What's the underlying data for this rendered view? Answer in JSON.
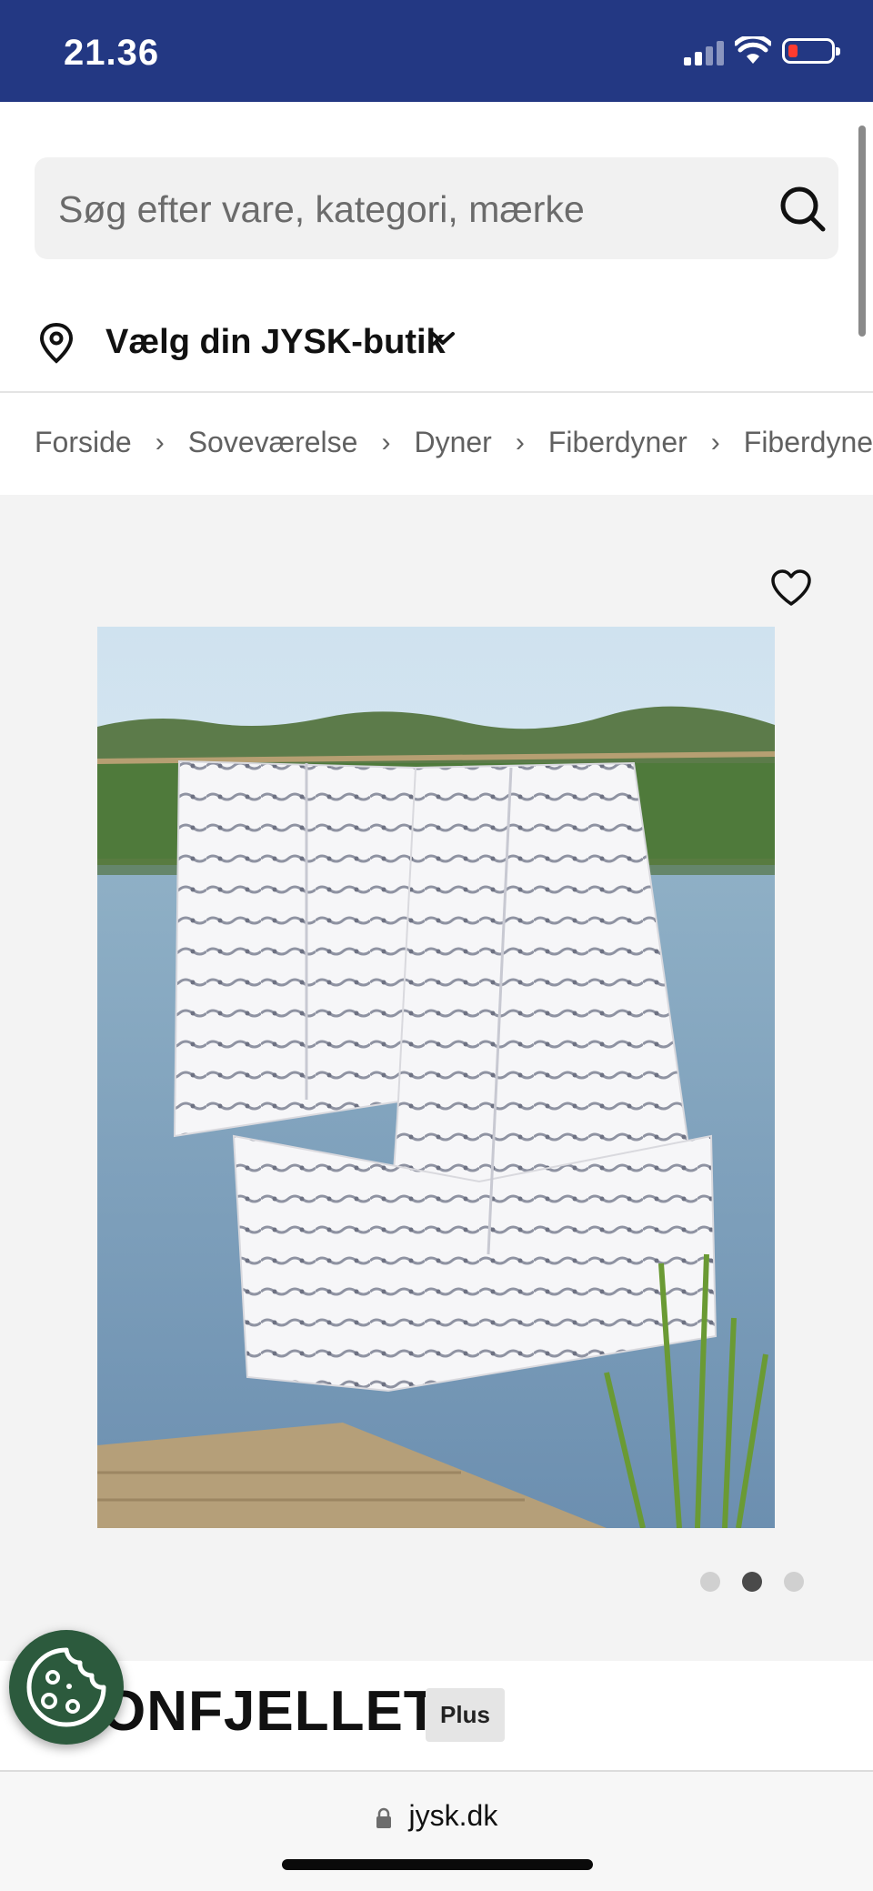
{
  "status_bar": {
    "time": "21.36",
    "background": "#233883",
    "battery_color": "#ff3b30"
  },
  "search": {
    "placeholder": "Søg efter vare, kategori, mærke"
  },
  "store_selector": {
    "label": "Vælg din JYSK-butik"
  },
  "breadcrumb": [
    "Forside",
    "Soveværelse",
    "Dyner",
    "Fiberdyner",
    "Fiberdyner"
  ],
  "gallery": {
    "image_count": 3,
    "active_index": 1
  },
  "product": {
    "title": "ONFJELLET",
    "badge": "Plus"
  },
  "browser": {
    "url": "jysk.dk"
  },
  "colors": {
    "accent": "#233883",
    "cookie_button": "#2c5a3d"
  }
}
